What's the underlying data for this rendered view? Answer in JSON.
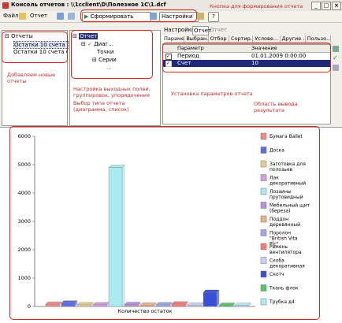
{
  "window": {
    "title": "Консоль отчетов : \\\\1cclient\\D\\Полезное 1С\\1.dcf"
  },
  "menu": {
    "file": "Файл",
    "report": "Отчет",
    "generate": "Сформировать",
    "settings": "Настройки",
    "help": "?"
  },
  "notes": {
    "generate_btn": "Кнопка для формирования отчета",
    "add_reports": "Добавляем новые отчеты",
    "fields_setup": "Настройка выходных полей, группировок, упорядочения",
    "type_choice": "Выбор типа отчета (диаграмма, список)",
    "params_setup": "Установка параметров отчета",
    "output_area": "Область вывода результата"
  },
  "left_tree": {
    "root": "Отчеты",
    "items": [
      "Остатки 10 счета Д...",
      "Остатки 10 счета Ст..."
    ]
  },
  "mid_tree": {
    "root": "Отчет",
    "diagram": "Диаг...",
    "points": "Точки",
    "series": "Серии",
    "extra": "..."
  },
  "settings_panel": {
    "label": "Настройки:",
    "value": "Отчет",
    "value2": "Отчет",
    "tabs": [
      "Параме...",
      "Выбран...",
      "Отбор",
      "Сортир...",
      "Услове...",
      "Другие ...",
      "Пользо..."
    ],
    "col_param": "Параметр",
    "col_value": "Значение",
    "rows": [
      {
        "name": "Период",
        "value": "01.01.2009 0:00:00"
      },
      {
        "name": "Счет",
        "value": "10"
      }
    ]
  },
  "chart_data": {
    "type": "bar",
    "xlabel": "Количество остаток",
    "ylim": [
      0,
      6000
    ],
    "yticks": [
      0,
      1000,
      2000,
      3000,
      4000,
      5000,
      6000
    ],
    "series": [
      {
        "name": "Бумага Ballet",
        "value": 80,
        "color": "#f08a8a"
      },
      {
        "name": "Доска",
        "value": 120,
        "color": "#5b6ee0"
      },
      {
        "name": "Заготовка для полозьев",
        "value": 60,
        "color": "#e2d090"
      },
      {
        "name": "Лак декоративный",
        "value": 60,
        "color": "#cfa0d8"
      },
      {
        "name": "Лозаины прутовидный",
        "value": 4900,
        "color": "#a8ecf2"
      },
      {
        "name": "Мебельный щит (береза)",
        "value": 70,
        "color": "#b890e0"
      },
      {
        "name": "Поддон деревянный",
        "value": 50,
        "color": "#e9b48a"
      },
      {
        "name": "Поролон \"British Vita Plc\"",
        "value": 60,
        "color": "#9aa8e8"
      },
      {
        "name": "Ремень вентилятора",
        "value": 90,
        "color": "#f07c7c"
      },
      {
        "name": "Скоба декоративная",
        "value": 50,
        "color": "#c8d0f0"
      },
      {
        "name": "Скотч",
        "value": 500,
        "color": "#3a4fd8"
      },
      {
        "name": "Ткань флок",
        "value": 40,
        "color": "#58c46a"
      },
      {
        "name": "Трубка д4",
        "value": 40,
        "color": "#b4e8f0"
      }
    ]
  }
}
